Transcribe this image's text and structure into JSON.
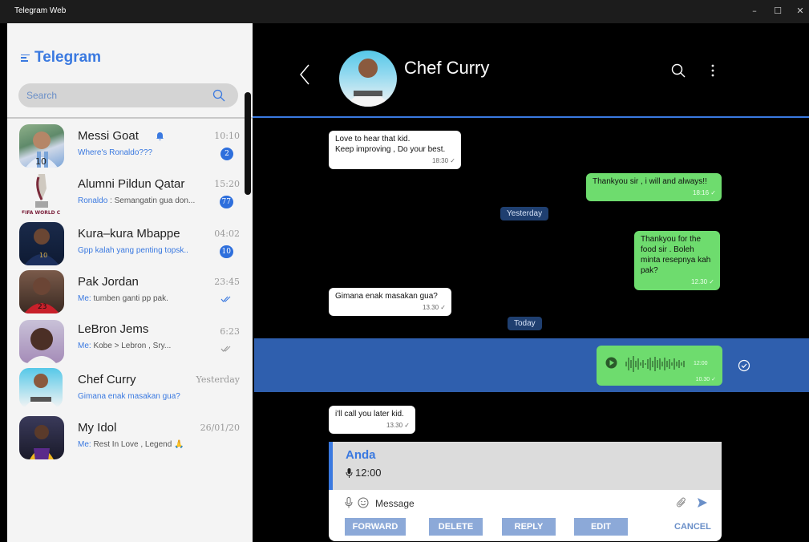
{
  "window": {
    "title": "Telegram Web",
    "controls": [
      "–",
      "☐",
      "✕"
    ]
  },
  "sidebar": {
    "logo": "Telegram",
    "search_placeholder": "Search",
    "chats": [
      {
        "name": "Messi Goat",
        "sender": "",
        "preview": "Where's Ronaldo???",
        "time": "10:10",
        "badge": "2",
        "muted_icon": "bell-icon"
      },
      {
        "name": "Alumni Pildun Qatar",
        "sender": "Ronaldo",
        "preview": " : Semangatin gua don...",
        "time": "15:20",
        "badge": "77"
      },
      {
        "name": "Kura–kura Mbappe",
        "sender": "",
        "preview": "Gpp kalah yang penting topsk..",
        "time": "04:02",
        "badge": "10"
      },
      {
        "name": "Pak Jordan",
        "sender": "Me:",
        "preview": " tumben ganti pp pak.",
        "time": "23:45",
        "status": "read"
      },
      {
        "name": "LeBron Jems",
        "sender": "Me:",
        "preview": " Kobe > Lebron , Sry...",
        "time": "6:23",
        "status": "sent"
      },
      {
        "name": "Chef Curry",
        "sender": "",
        "preview": "Gimana enak masakan gua?",
        "time": "Yesterday"
      },
      {
        "name": "My Idol",
        "sender": "Me:",
        "preview": " Rest In Love , Legend 🙏",
        "time": "26/01/20"
      }
    ]
  },
  "chat": {
    "name": "Chef Curry",
    "messages": [
      {
        "dir": "in",
        "lines": [
          "Love to hear that kid.",
          "Keep improving , Do your best."
        ],
        "time": "18:30 ✓"
      },
      {
        "dir": "out",
        "lines": [
          "Thankyou sir , i will and always!!"
        ],
        "time": "18:16 ✓"
      },
      {
        "dir": "out",
        "lines": [
          "Thankyou for the",
          "food sir . Boleh",
          "minta resepnya kah",
          "pak?"
        ],
        "time": "12.30 ✓"
      },
      {
        "dir": "in",
        "lines": [
          "Gimana enak masakan gua?"
        ],
        "time": "13.30 ✓"
      },
      {
        "dir": "in",
        "lines": [
          "i'll call you later kid."
        ],
        "time": "13.30 ✓"
      }
    ],
    "date_yesterday": "Yesterday",
    "date_today": "Today",
    "voice": {
      "duration": "12:00",
      "time": "10.30 ✓"
    },
    "reply": {
      "name": "Anda",
      "text": "12:00"
    },
    "composer": {
      "placeholder": "Message",
      "buttons": {
        "forward": "FORWARD",
        "delete": "DELETE",
        "reply": "REPLY",
        "edit": "EDIT",
        "cancel": "CANCEL"
      }
    }
  },
  "colors": {
    "accent": "#3a79e0",
    "outgoing": "#6edc6e",
    "selected": "#2f5fae"
  }
}
